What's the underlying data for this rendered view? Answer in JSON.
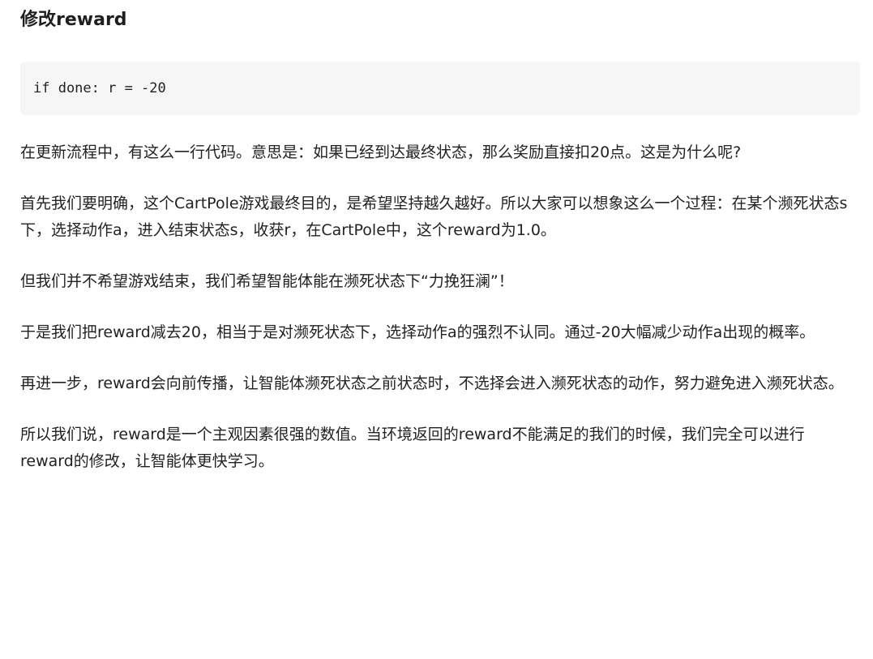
{
  "heading": "修改reward",
  "code": "if done: r = -20",
  "paragraphs": [
    "在更新流程中，有这么一行代码。意思是：如果已经到达最终状态，那么奖励直接扣20点。这是为什么呢?",
    "首先我们要明确，这个CartPole游戏最终目的，是希望坚持越久越好。所以大家可以想象这么一个过程：在某个濒死状态s下，选择动作a，进入结束状态s，收获r，在CartPole中，这个reward为1.0。",
    "但我们并不希望游戏结束，我们希望智能体能在濒死状态下“力挽狂澜”！",
    "于是我们把reward减去20，相当于是对濒死状态下，选择动作a的强烈不认同。通过-20大幅减少动作a出现的概率。",
    "再进一步，reward会向前传播，让智能体濒死状态之前状态时，不选择会进入濒死状态的动作，努力避免进入濒死状态。",
    "所以我们说，reward是一个主观因素很强的数值。当环境返回的reward不能满足的我们的时候，我们完全可以进行reward的修改，让智能体更快学习。"
  ]
}
